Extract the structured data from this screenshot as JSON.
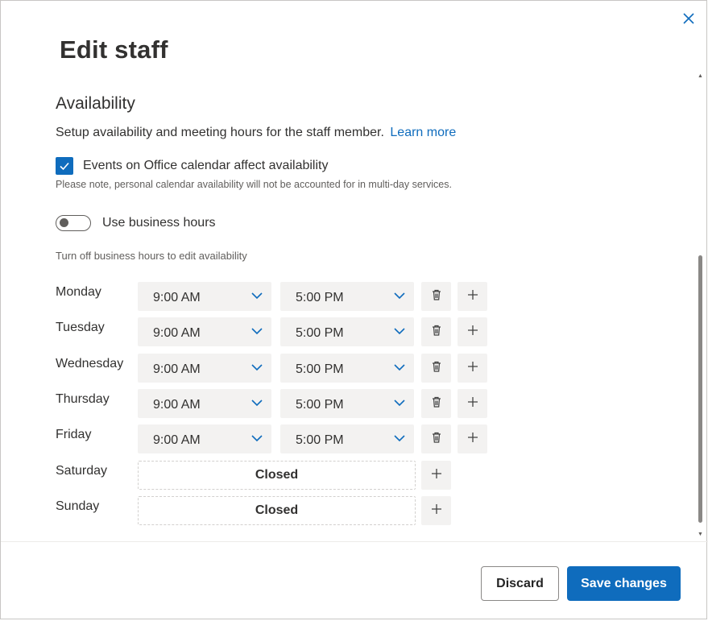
{
  "dialog": {
    "title": "Edit staff",
    "close_icon": "close-icon"
  },
  "availability": {
    "heading": "Availability",
    "description": "Setup availability and meeting hours for the staff member.",
    "learn_more": "Learn more",
    "calendar_checkbox": {
      "label": "Events on Office calendar affect availability",
      "checked": true
    },
    "note": "Please note, personal calendar availability will not be accounted for in multi-day services.",
    "business_hours_toggle": {
      "label": "Use business hours",
      "on": false
    },
    "hint": "Turn off business hours to edit availability",
    "days": [
      {
        "name": "Monday",
        "start": "9:00 AM",
        "end": "5:00 PM",
        "closed": false
      },
      {
        "name": "Tuesday",
        "start": "9:00 AM",
        "end": "5:00 PM",
        "closed": false
      },
      {
        "name": "Wednesday",
        "start": "9:00 AM",
        "end": "5:00 PM",
        "closed": false
      },
      {
        "name": "Thursday",
        "start": "9:00 AM",
        "end": "5:00 PM",
        "closed": false
      },
      {
        "name": "Friday",
        "start": "9:00 AM",
        "end": "5:00 PM",
        "closed": false
      },
      {
        "name": "Saturday",
        "closed": true,
        "closed_label": "Closed"
      },
      {
        "name": "Sunday",
        "closed": true,
        "closed_label": "Closed"
      }
    ]
  },
  "footer": {
    "discard_label": "Discard",
    "save_label": "Save changes"
  },
  "colors": {
    "accent": "#0f6cbd",
    "field_bg": "#f3f2f1",
    "text": "#323130"
  }
}
